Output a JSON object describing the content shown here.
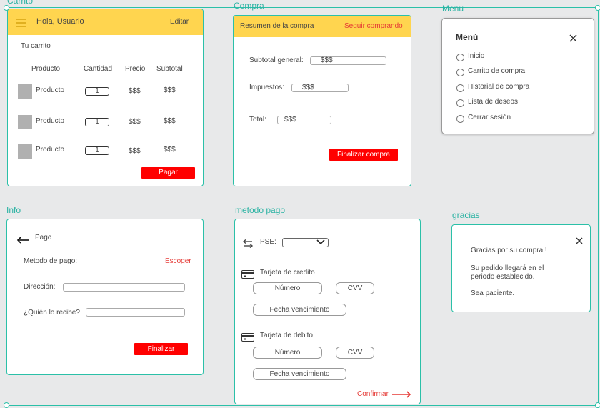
{
  "frames": {
    "carrito": "Carrito",
    "compra": "Compra",
    "menu": "Menu",
    "info": "Info",
    "metodo_pago": "metodo pago",
    "gracias": "gracias"
  },
  "carrito": {
    "greeting": "Hola, Usuario",
    "edit": "Editar",
    "subtitle": "Tu carrito",
    "headers": [
      "Producto",
      "Cantidad",
      "Precio",
      "Subtotal"
    ],
    "rows": [
      {
        "product": "Producto",
        "qty": "1",
        "price": "$$$",
        "subtotal": "$$$"
      },
      {
        "product": "Producto",
        "qty": "1",
        "price": "$$$",
        "subtotal": "$$$"
      },
      {
        "product": "Producto",
        "qty": "1",
        "price": "$$$",
        "subtotal": "$$$"
      }
    ],
    "pay": "Pagar"
  },
  "compra": {
    "title": "Resumen de la compra",
    "continue": "Seguir comprando",
    "subtotal_label": "Subtotal general:",
    "subtotal_value": "$$$",
    "tax_label": "Impuestos:",
    "tax_value": "$$$",
    "total_label": "Total:",
    "total_value": "$$$",
    "finish": "Finalizar compra"
  },
  "menu": {
    "title": "Menú",
    "items": [
      "Inicio",
      "Carrito de compra",
      "Historial de compra",
      "Lista de deseos",
      "Cerrar sesión"
    ]
  },
  "info": {
    "back": "Pago",
    "method_label": "Metodo de pago:",
    "method_action": "Escoger",
    "address_label": "Dirección:",
    "receiver_label": "¿Quién lo recibe?",
    "finish": "Finalizar"
  },
  "metodo": {
    "pse_label": "PSE:",
    "credit_label": "Tarjeta de credito",
    "debit_label": "Tarjeta de debito",
    "number": "Número",
    "cvv": "CVV",
    "expiry": "Fecha vencimiento",
    "confirm": "Confirmar"
  },
  "gracias": {
    "line1": "Gracias por su compra!!",
    "line2": "Su pedido llegará en el periodo establecido.",
    "line3": "Sea paciente."
  },
  "colors": {
    "accent": "#2bc0a8",
    "header": "#ffd54f",
    "action": "#ff0000"
  }
}
